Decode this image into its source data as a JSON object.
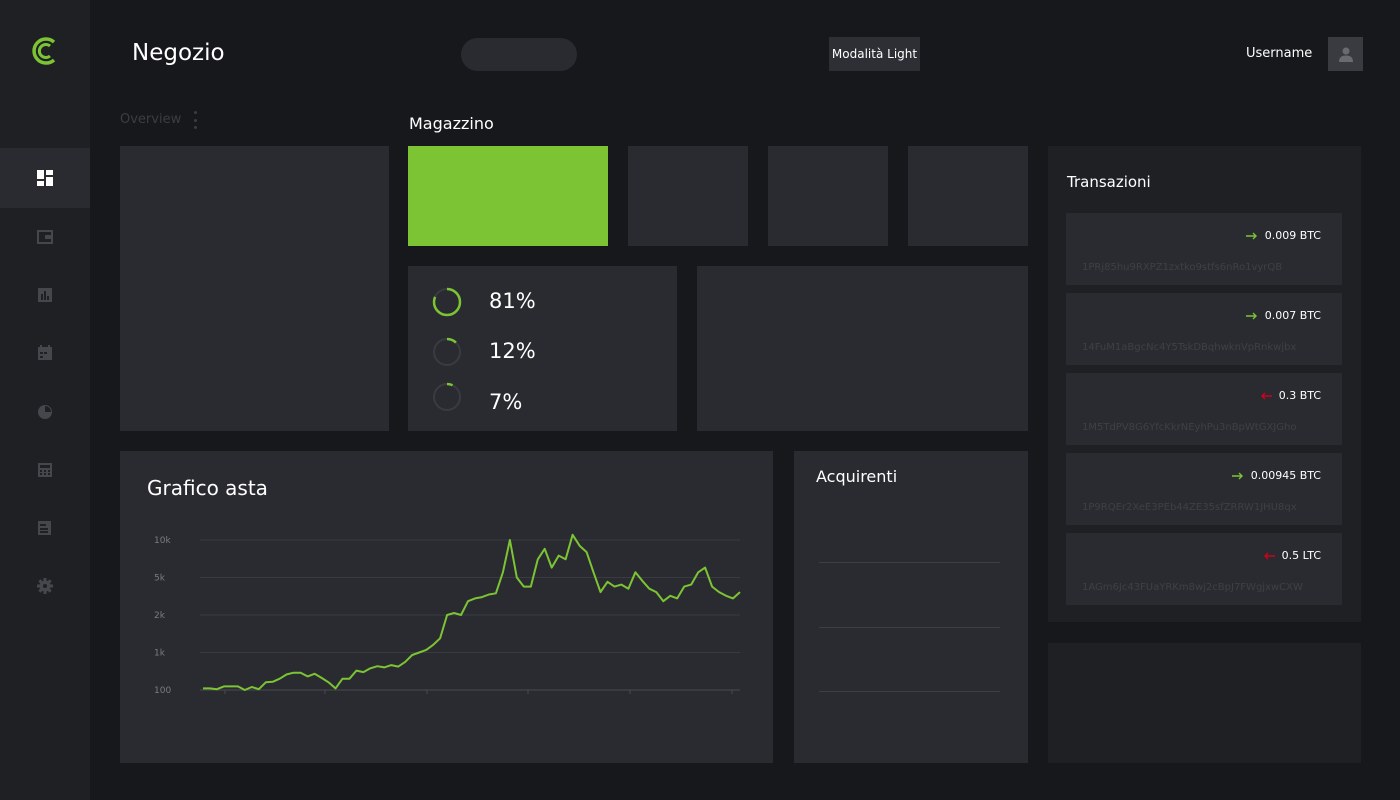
{
  "header": {
    "title": "Negozio",
    "mode_button": "Modalità Light",
    "username": "Username"
  },
  "sidebar": {
    "logo": "C",
    "items": [
      {
        "icon": "dashboard-icon",
        "active": true
      },
      {
        "icon": "wallet-icon",
        "active": false
      },
      {
        "icon": "bar-chart-icon",
        "active": false
      },
      {
        "icon": "calendar-icon",
        "active": false
      },
      {
        "icon": "pie-chart-icon",
        "active": false
      },
      {
        "icon": "calculator-icon",
        "active": false
      },
      {
        "icon": "document-icon",
        "active": false
      },
      {
        "icon": "settings-icon",
        "active": false
      }
    ]
  },
  "overview": {
    "label": "Overview"
  },
  "magazzino": {
    "label": "Magazzino",
    "stats": [
      {
        "value": 0.81,
        "label": "81%"
      },
      {
        "value": 0.12,
        "label": "12%"
      },
      {
        "value": 0.07,
        "label": "7%"
      }
    ]
  },
  "chart": {
    "title": "Grafico asta",
    "chart_data": {
      "type": "line",
      "yscale": "log",
      "yticks": [
        "100",
        "1k",
        "2k",
        "5k",
        "10k"
      ],
      "series": [
        {
          "values": [
            110,
            110,
            105,
            125,
            125,
            125,
            95,
            120,
            105,
            160,
            165,
            200,
            260,
            290,
            290,
            230,
            270,
            210,
            160,
            110,
            200,
            200,
            330,
            300,
            380,
            430,
            400,
            460,
            420,
            560,
            860,
            1000,
            1050,
            1150,
            1300,
            2000,
            2100,
            2000,
            2800,
            3000,
            3100,
            3300,
            3400,
            5500,
            10000,
            5000,
            4000,
            4000,
            7000,
            8500,
            6000,
            7500,
            7000,
            11000,
            9000,
            8000,
            5500,
            3500,
            4500,
            4000,
            4200,
            3800,
            5500,
            4600,
            3800,
            3500,
            2800,
            3200,
            3000,
            4000,
            4200,
            5500,
            6000,
            4000,
            3500,
            3200,
            3000,
            3500
          ]
        }
      ],
      "color": "#7cc434"
    }
  },
  "acquirenti": {
    "label": "Acquirenti"
  },
  "transazioni": {
    "label": "Transazioni",
    "items": [
      {
        "direction": "in",
        "amount": "0.009 BTC",
        "address": "1PRj85hu9RXPZ1zxtko9stfs6nRo1vyrQB"
      },
      {
        "direction": "in",
        "amount": "0.007 BTC",
        "address": "14FuM1aBgcNc4Y5TskDBqhwknVpRnkwjbx"
      },
      {
        "direction": "out",
        "amount": "0.3 BTC",
        "address": "1M5TdPV8G6YfcKkrNEyhPu3nBpWtGXJGho"
      },
      {
        "direction": "in",
        "amount": "0.00945 BTC",
        "address": "1P9RQEr2XeE3PEb44ZE35sfZRRW1JHU8qx"
      },
      {
        "direction": "out",
        "amount": "0.5 LTC",
        "address": "1AGm6Jc43FUaYRKm8wj2cBpJ7FWgjxwCXW"
      }
    ]
  },
  "colors": {
    "accent": "#7cc434",
    "negative": "#d0021b",
    "background": "#17181c",
    "card": "#1f2024"
  }
}
